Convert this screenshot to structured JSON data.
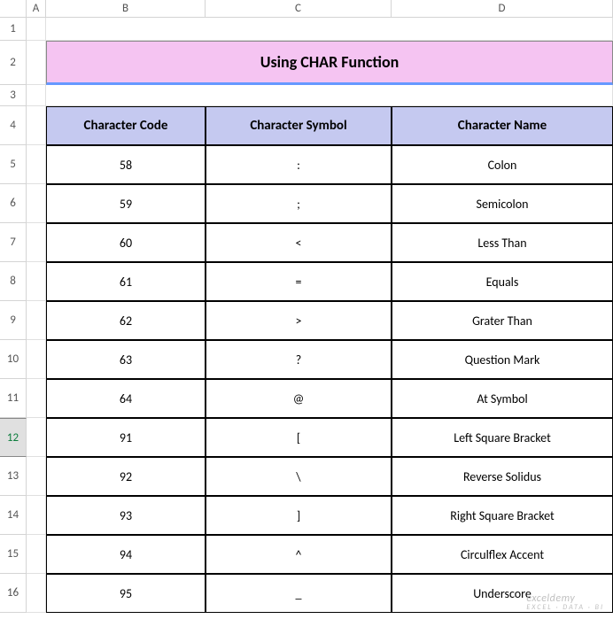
{
  "columns": [
    "A",
    "B",
    "C",
    "D"
  ],
  "row_numbers": [
    1,
    2,
    3,
    4,
    5,
    6,
    7,
    8,
    9,
    10,
    11,
    12,
    13,
    14,
    15,
    16
  ],
  "selected_row": 12,
  "title": "Using CHAR Function",
  "headers": {
    "b": "Character Code",
    "c": "Character Symbol",
    "d": "Character Name"
  },
  "chart_data": {
    "type": "table",
    "columns": [
      "Character Code",
      "Character Symbol",
      "Character Name"
    ],
    "rows": [
      {
        "code": "58",
        "symbol": ":",
        "name": "Colon"
      },
      {
        "code": "59",
        "symbol": ";",
        "name": "Semicolon"
      },
      {
        "code": "60",
        "symbol": "<",
        "name": "Less Than"
      },
      {
        "code": "61",
        "symbol": "=",
        "name": "Equals"
      },
      {
        "code": "62",
        "symbol": ">",
        "name": "Grater Than"
      },
      {
        "code": "63",
        "symbol": "?",
        "name": "Question Mark"
      },
      {
        "code": "64",
        "symbol": "@",
        "name": "At Symbol"
      },
      {
        "code": "91",
        "symbol": "[",
        "name": "Left Square Bracket"
      },
      {
        "code": "92",
        "symbol": "\\",
        "name": "Reverse Solidus"
      },
      {
        "code": "93",
        "symbol": "]",
        "name": "Right Square Bracket"
      },
      {
        "code": "94",
        "symbol": "^",
        "name": "Circulflex Accent"
      },
      {
        "code": "95",
        "symbol": "_",
        "name": "Underscore"
      }
    ]
  },
  "watermark": {
    "main": "exceldemy",
    "sub": "EXCEL · DATA · BI"
  }
}
